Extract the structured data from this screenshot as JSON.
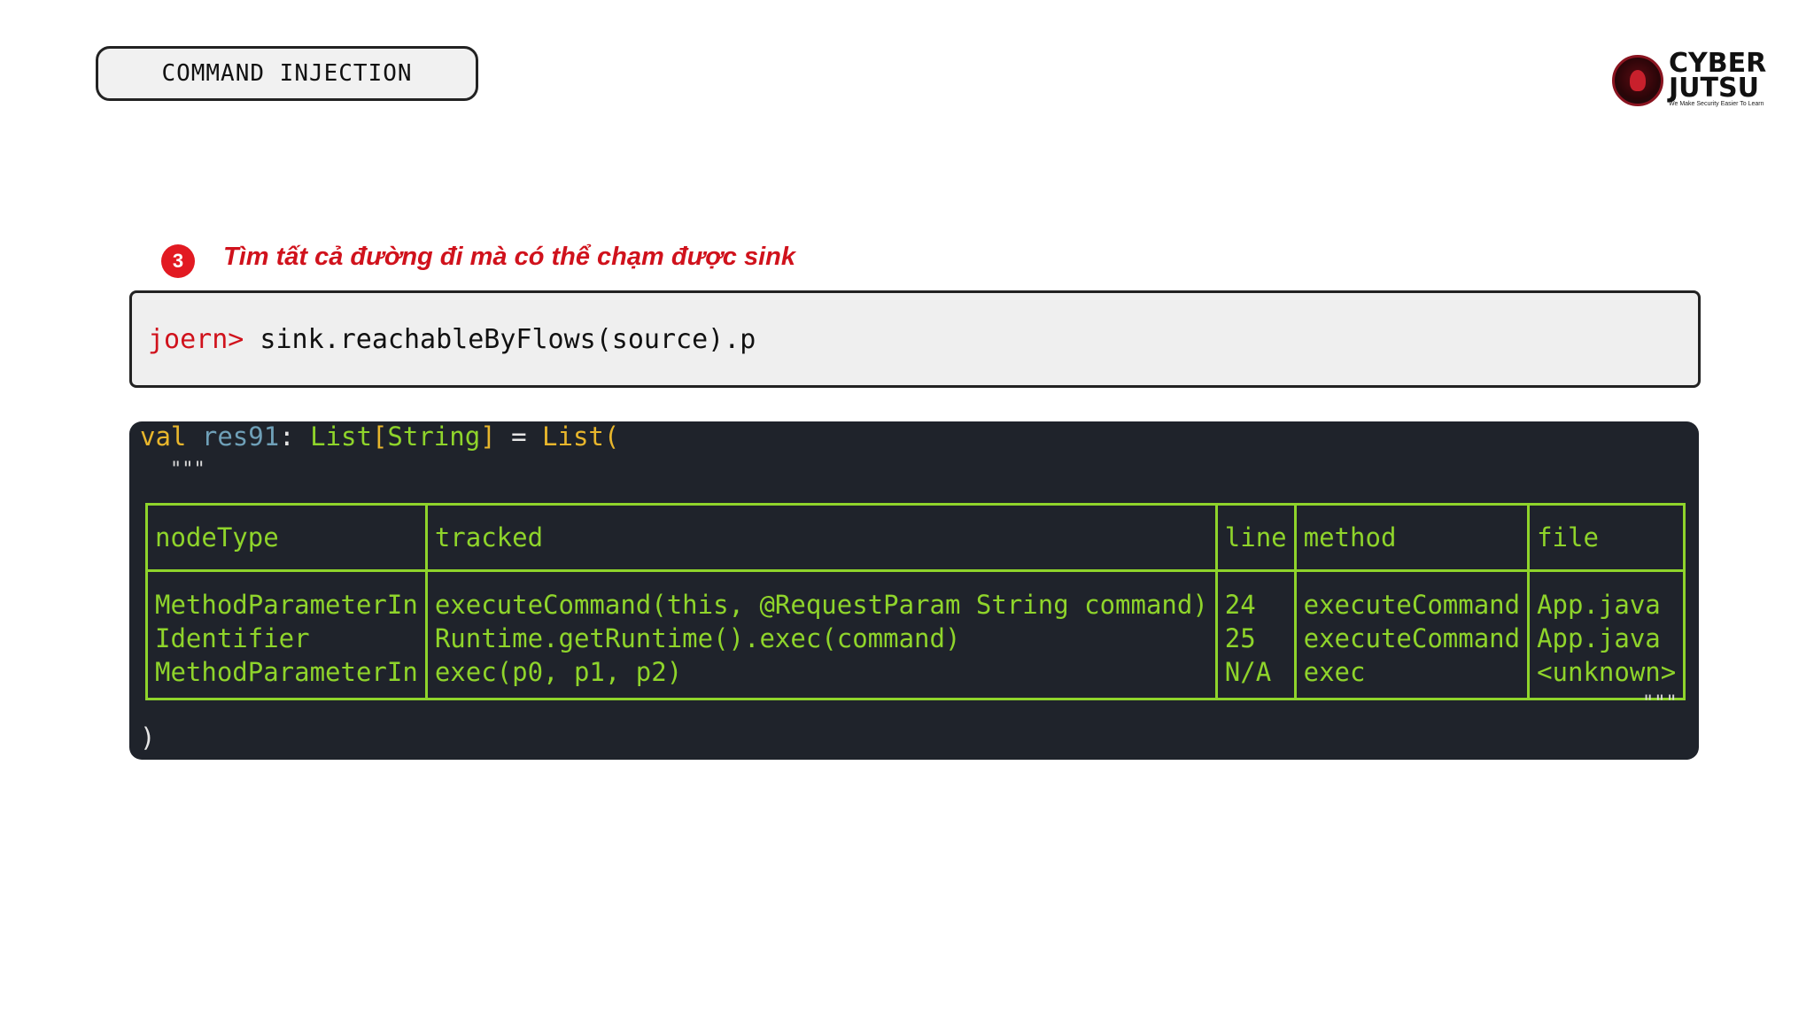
{
  "header": {
    "section_tag": "COMMAND INJECTION"
  },
  "logo": {
    "word_line1": "CYBER",
    "word_line2": "JUTSU",
    "tagline": "We Make Security Easier To Learn"
  },
  "step": {
    "number": "3",
    "title": "Tìm tất cả đường đi mà có thể chạm được sink",
    "badge_color": "#e21a22"
  },
  "command": {
    "prompt": "joern>",
    "text": " sink.reachableByFlows(source).p"
  },
  "output": {
    "decl_keyword": "val",
    "decl_name": "res91",
    "decl_colon": ":",
    "decl_type": "List",
    "decl_bracket_open": "[",
    "decl_type_param": "String",
    "decl_bracket_close": "]",
    "decl_equals": " = ",
    "decl_ctor": "List(",
    "open_quotes": "\"\"\"",
    "close_quotes": "\"\"\"",
    "closing_paren": ")",
    "table": {
      "headers": [
        "nodeType",
        "tracked",
        "line",
        "method",
        "file"
      ],
      "rows": [
        [
          "MethodParameterIn",
          "executeCommand(this, @RequestParam String command)",
          "24",
          "executeCommand",
          "App.java"
        ],
        [
          "Identifier",
          "Runtime.getRuntime().exec(command)",
          "25",
          "executeCommand",
          "App.java"
        ],
        [
          "MethodParameterIn",
          "exec(p0, p1, p2)",
          "N/A",
          "exec",
          "<unknown>"
        ]
      ]
    }
  },
  "colors": {
    "accent_red": "#d0121c",
    "terminal_bg": "#1f232b",
    "terminal_green": "#8fd42b",
    "keyword_yellow": "#e8b62c"
  }
}
